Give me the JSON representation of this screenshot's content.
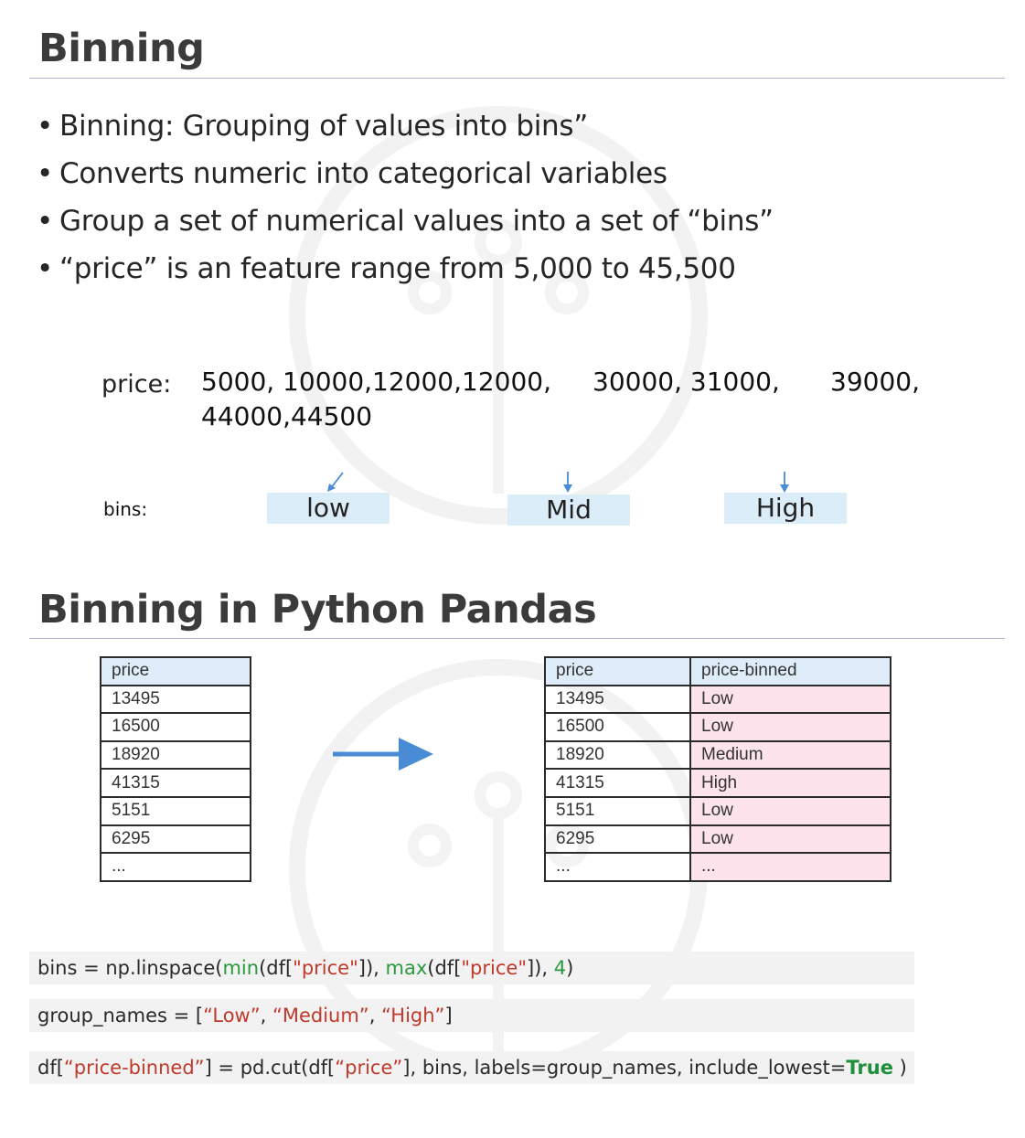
{
  "section1": {
    "title": "Binning",
    "bullets": [
      "Binning: Grouping of values into bins”",
      "Converts numeric into categorical variables",
      "Group a set of numerical values into a set of “bins”",
      "“price” is an feature range from 5,000 to 45,500"
    ],
    "price_label": "price:",
    "price_values": {
      "low_group": "5000, 10000,12000,12000,",
      "mid_group": "30000, 31000,",
      "high_group": "39000,",
      "high_group_cont": "44000,44500"
    },
    "bins_label": "bins:",
    "bins": [
      "low",
      "Mid",
      "High"
    ]
  },
  "section2": {
    "title": "Binning in Python Pandas",
    "left_table": {
      "header": "price",
      "rows": [
        "13495",
        "16500",
        "18920",
        "41315",
        "5151",
        "6295",
        "..."
      ]
    },
    "right_table": {
      "headers": [
        "price",
        "price-binned"
      ],
      "rows": [
        [
          "13495",
          "Low"
        ],
        [
          "16500",
          "Low"
        ],
        [
          "18920",
          "Medium"
        ],
        [
          "41315",
          "High"
        ],
        [
          "5151",
          "Low"
        ],
        [
          "6295",
          "Low"
        ],
        [
          "...",
          "..."
        ]
      ]
    },
    "code": {
      "line1": {
        "p1": "bins = np.linspace(",
        "fn1": "min",
        "p2": "(df[",
        "s1": "\"price\"",
        "p3": "]), ",
        "fn2": "max",
        "p4": "(df[",
        "s2": "\"price\"",
        "p5": "]), ",
        "n1": "4",
        "p6": ")"
      },
      "line2": {
        "p1": "group_names = [",
        "s1": "“Low”",
        "p2": ", ",
        "s2": "“Medium”",
        "p3": ", ",
        "s3": "“High”",
        "p4": "]"
      },
      "line3": {
        "p1": "df[",
        "s1": "“price-binned”",
        "p2": "] = pd.cut(df[",
        "s2": "“price”",
        "p3": "], bins, labels=group_names, include_lowest=",
        "kw": "True",
        "p4": " )"
      }
    }
  },
  "colors": {
    "title": "#3b3b3b",
    "rule": "#b9b6cf",
    "bin_box": "#dcedfa",
    "table_header": "#deedf9",
    "table_pink": "#fde4ec",
    "arrow": "#4a8bd6",
    "code_bg": "#f2f2f2",
    "code_green": "#2a9a3f",
    "code_red": "#c0392b"
  },
  "icons": [
    "watermark-logo",
    "down-arrow-icon",
    "right-arrow-icon"
  ]
}
